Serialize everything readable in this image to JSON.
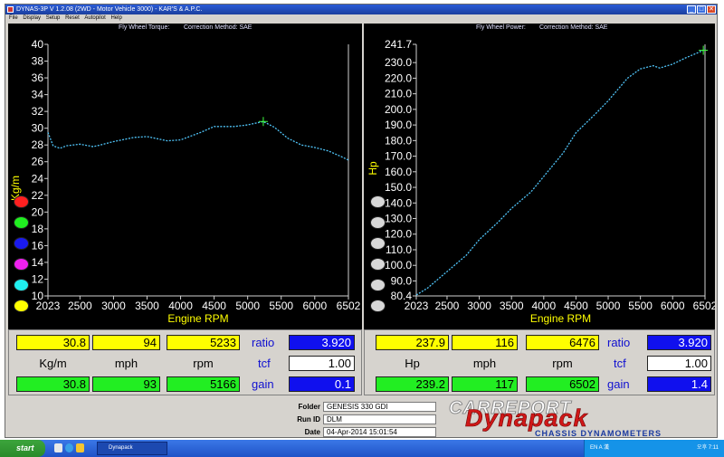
{
  "window": {
    "title": "DYNAS-3P V 1.2.08 (2WD - Motor Vehicle 3000) - KAR'S & A.P.C.",
    "minimize": "_",
    "maximize": "□",
    "close": "✕"
  },
  "menu": [
    "File",
    "Display",
    "Setup",
    "Reset",
    "Autopilot",
    "Help"
  ],
  "torque_panel": {
    "header": "Fly Wheel Torque:",
    "correction": "Correction Method: SAE",
    "ylabel": "Kg/m",
    "xlabel": "Engine RPM",
    "lamp_colors": [
      "#ff2020",
      "#20ee20",
      "#1a1aee",
      "#ee20ee",
      "#20eeee",
      "#ffff00"
    ]
  },
  "power_panel": {
    "header": "Fly Wheel Power:",
    "correction": "Correction Method: SAE",
    "ylabel": "Hp",
    "xlabel": "Engine RPM",
    "lamp_colors": [
      "#d8d8d8",
      "#d8d8d8",
      "#d8d8d8",
      "#d8d8d8",
      "#d8d8d8",
      "#d8d8d8"
    ]
  },
  "torque_info": {
    "row1": [
      "30.8",
      "94",
      "5233"
    ],
    "units": [
      "Kg/m",
      "mph",
      "rpm"
    ],
    "row3": [
      "30.8",
      "93",
      "5166"
    ],
    "labels": [
      "ratio",
      "tcf",
      "gain"
    ],
    "right_values": [
      "3.920",
      "1.00",
      "0.1"
    ]
  },
  "power_info": {
    "row1": [
      "237.9",
      "116",
      "6476"
    ],
    "units": [
      "Hp",
      "mph",
      "rpm"
    ],
    "row3": [
      "239.2",
      "117",
      "6502"
    ],
    "labels": [
      "ratio",
      "tcf",
      "gain"
    ],
    "right_values": [
      "3.920",
      "1.00",
      "1.4"
    ]
  },
  "footer": {
    "folder_label": "Folder",
    "folder_value": "GENESIS 330 GDI",
    "runid_label": "Run ID",
    "runid_value": "DLM",
    "date_label": "Date",
    "date_value": "04-Apr-2014   15:01:54",
    "logo_top": "CARREPORT",
    "logo_main": "Dynapack",
    "logo_sub": "CHASSIS   DYNAMOMETERS"
  },
  "taskbar": {
    "start": "start",
    "task": "Dynapack",
    "tray_text": "EN A 漢 ",
    "clock": "오후 7:11"
  },
  "colors": {
    "curve": "#4fc3f7",
    "axis": "#d0d0d0",
    "axis_text": "#ffffff",
    "xlabel": "#ffff00",
    "marker": "#40ff40",
    "logo_red": "#d01818",
    "logo_blue": "#1a3aa0"
  },
  "chart_data": [
    {
      "type": "line",
      "title": "Fly Wheel Torque:",
      "xlabel": "Engine RPM",
      "ylabel": "Kg/m",
      "xlim": [
        2023,
        6502
      ],
      "ylim": [
        10,
        40
      ],
      "x_ticks": [
        2023,
        2500,
        3000,
        3500,
        4000,
        4500,
        5000,
        5500,
        6000,
        6502
      ],
      "y_ticks": [
        10,
        12,
        14,
        16,
        18,
        20,
        22,
        24,
        26,
        28,
        30,
        32,
        34,
        36,
        38,
        40
      ],
      "series": [
        {
          "x": [
            2023,
            2100,
            2200,
            2300,
            2500,
            2700,
            3000,
            3300,
            3500,
            3800,
            4000,
            4300,
            4500,
            4800,
            5000,
            5233,
            5400,
            5600,
            5800,
            6000,
            6200,
            6400,
            6502
          ],
          "y": [
            29.5,
            27.9,
            27.6,
            27.9,
            28.1,
            27.8,
            28.4,
            28.9,
            29.0,
            28.5,
            28.6,
            29.5,
            30.2,
            30.2,
            30.4,
            30.8,
            30.1,
            28.8,
            28.0,
            27.7,
            27.3,
            26.6,
            26.2
          ]
        }
      ],
      "marker": {
        "x": 5233,
        "y": 30.8
      }
    },
    {
      "type": "line",
      "title": "Fly Wheel Power:",
      "xlabel": "Engine RPM",
      "ylabel": "Hp",
      "xlim": [
        2023,
        6502
      ],
      "ylim": [
        80.4,
        241.7
      ],
      "x_ticks": [
        2023,
        2500,
        3000,
        3500,
        4000,
        4500,
        5000,
        5500,
        6000,
        6502
      ],
      "y_ticks": [
        80.4,
        90.0,
        100.0,
        110.0,
        120.0,
        130.0,
        140.0,
        150.0,
        160.0,
        170.0,
        180.0,
        190.0,
        200.0,
        210.0,
        220.0,
        230.0,
        241.7
      ],
      "series": [
        {
          "x": [
            2023,
            2200,
            2500,
            2800,
            3000,
            3300,
            3500,
            3800,
            4000,
            4300,
            4500,
            4800,
            5000,
            5300,
            5500,
            5700,
            5800,
            6000,
            6200,
            6400,
            6476,
            6502
          ],
          "y": [
            81.0,
            85.5,
            96.0,
            106.5,
            116.5,
            128.0,
            136.5,
            147.0,
            157.0,
            172.0,
            185.0,
            197.0,
            205.5,
            220.0,
            226.0,
            228.0,
            226.5,
            229.0,
            233.0,
            236.5,
            237.9,
            239.2
          ]
        }
      ],
      "marker": {
        "x": 6476,
        "y": 237.9
      }
    }
  ]
}
